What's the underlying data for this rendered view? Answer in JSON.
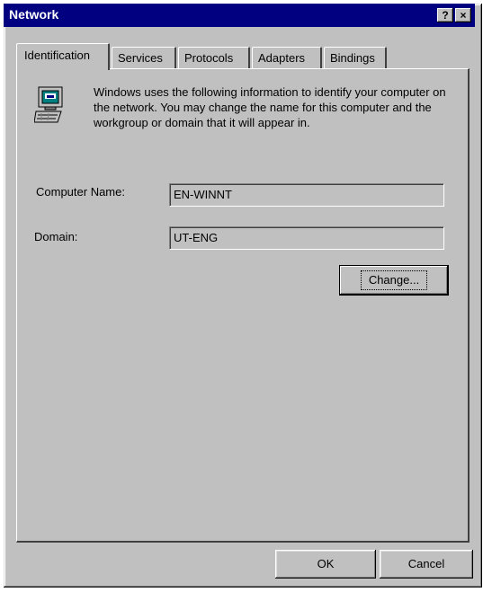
{
  "window": {
    "title": "Network",
    "help_glyph": "?",
    "close_glyph": "×"
  },
  "tabs": [
    {
      "label": "Identification",
      "active": true
    },
    {
      "label": "Services"
    },
    {
      "label": "Protocols"
    },
    {
      "label": "Adapters"
    },
    {
      "label": "Bindings"
    }
  ],
  "identification": {
    "description": "Windows uses the following information to identify your computer on the network.  You may change the name for this computer and the workgroup or domain that it will appear in.",
    "computer_name_label": "Computer Name:",
    "computer_name_value": "EN-WINNT",
    "domain_label": "Domain:",
    "domain_value": "UT-ENG",
    "change_button_label": "Change..."
  },
  "footer": {
    "ok_label": "OK",
    "cancel_label": "Cancel"
  },
  "colors": {
    "titlebar": "#000080",
    "face": "#c0c0c0"
  },
  "icons": {
    "computer": "computer-network-icon"
  }
}
